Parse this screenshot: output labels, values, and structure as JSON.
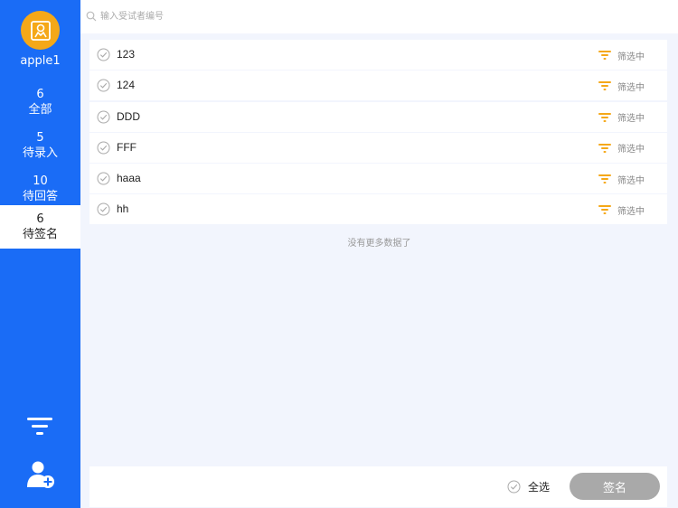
{
  "sidebar": {
    "username": "apple1",
    "avatar_color": "#f5a818",
    "nav": [
      {
        "count": "6",
        "label": "全部"
      },
      {
        "count": "5",
        "label": "待录入"
      },
      {
        "count": "10",
        "label": "待回答"
      },
      {
        "count": "6",
        "label": "待签名"
      }
    ],
    "active_index": 3,
    "filter_icon": "filter-icon",
    "add_user_icon": "add-user-icon"
  },
  "search": {
    "placeholder": "输入受试者编号",
    "icon": "search-icon"
  },
  "list": {
    "rows": [
      {
        "name": "123",
        "filter_text": "筛选中"
      },
      {
        "name": "124",
        "filter_text": "筛选中"
      },
      {
        "name": "DDD",
        "filter_text": "筛选中"
      },
      {
        "name": "FFF",
        "filter_text": "筛选中"
      },
      {
        "name": "haaa",
        "filter_text": "筛选中"
      },
      {
        "name": "hh",
        "filter_text": "筛选中"
      }
    ],
    "no_more_text": "没有更多数据了"
  },
  "footer": {
    "select_all_label": "全选",
    "sign_button_label": "签名"
  },
  "colors": {
    "sidebar": "#1a6cf6",
    "accent_filter": "#f5a818",
    "sign_button": "#a9a9a9",
    "background": "#f2f5fd"
  }
}
